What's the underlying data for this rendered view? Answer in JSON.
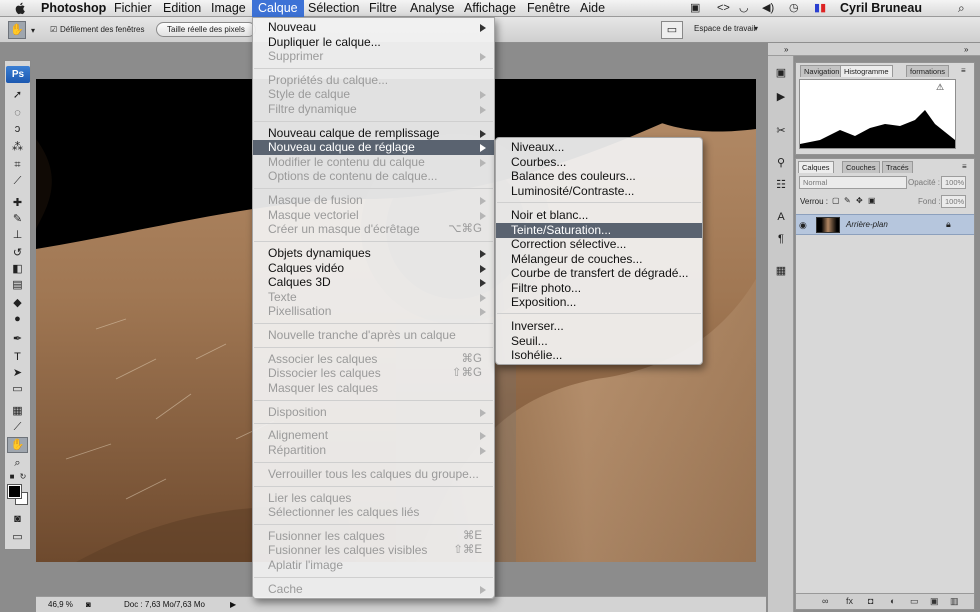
{
  "menubar": {
    "app": "Photoshop",
    "items": [
      "Fichier",
      "Edition",
      "Image",
      "Calque",
      "Sélection",
      "Filtre",
      "Analyse",
      "Affichage",
      "Fenêtre",
      "Aide"
    ],
    "active": "Calque",
    "user": "Cyril Bruneau"
  },
  "options": {
    "scroll_all": "Défilement des fenêtres",
    "actual_pixels": "Taille réelle des pixels",
    "workspace": "Espace de travail"
  },
  "tools": {
    "logo": "Ps"
  },
  "layer_menu": {
    "items": [
      {
        "label": "Nouveau",
        "enabled": true,
        "submenu": true
      },
      {
        "label": "Dupliquer le calque...",
        "enabled": true
      },
      {
        "label": "Supprimer",
        "enabled": false,
        "submenu": true
      },
      {
        "label": "Propriétés du calque...",
        "enabled": false
      },
      {
        "label": "Style de calque",
        "enabled": false,
        "submenu": true
      },
      {
        "label": "Filtre dynamique",
        "enabled": false,
        "submenu": true
      },
      {
        "label": "Nouveau calque de remplissage",
        "enabled": true,
        "submenu": true
      },
      {
        "label": "Nouveau calque de réglage",
        "enabled": true,
        "submenu": true,
        "highlighted": true
      },
      {
        "label": "Modifier le contenu du calque",
        "enabled": false,
        "submenu": true
      },
      {
        "label": "Options de contenu de calque...",
        "enabled": false
      },
      {
        "label": "Masque de fusion",
        "enabled": false,
        "submenu": true
      },
      {
        "label": "Masque vectoriel",
        "enabled": false,
        "submenu": true
      },
      {
        "label": "Créer un masque d'écrêtage",
        "enabled": false,
        "shortcut": "⌥⌘G"
      },
      {
        "label": "Objets dynamiques",
        "enabled": true,
        "submenu": true
      },
      {
        "label": "Calques vidéo",
        "enabled": true,
        "submenu": true
      },
      {
        "label": "Calques 3D",
        "enabled": true,
        "submenu": true
      },
      {
        "label": "Texte",
        "enabled": false,
        "submenu": true
      },
      {
        "label": "Pixellisation",
        "enabled": false,
        "submenu": true
      },
      {
        "label": "Nouvelle tranche d'après un calque",
        "enabled": false
      },
      {
        "label": "Associer les calques",
        "enabled": false,
        "shortcut": "⌘G"
      },
      {
        "label": "Dissocier les calques",
        "enabled": false,
        "shortcut": "⇧⌘G"
      },
      {
        "label": "Masquer les calques",
        "enabled": false
      },
      {
        "label": "Disposition",
        "enabled": false,
        "submenu": true
      },
      {
        "label": "Alignement",
        "enabled": false,
        "submenu": true
      },
      {
        "label": "Répartition",
        "enabled": false,
        "submenu": true
      },
      {
        "label": "Verrouiller tous les calques du groupe...",
        "enabled": false
      },
      {
        "label": "Lier les calques",
        "enabled": false
      },
      {
        "label": "Sélectionner les calques liés",
        "enabled": false
      },
      {
        "label": "Fusionner les calques",
        "enabled": false,
        "shortcut": "⌘E"
      },
      {
        "label": "Fusionner les calques visibles",
        "enabled": false,
        "shortcut": "⇧⌘E"
      },
      {
        "label": "Aplatir l'image",
        "enabled": false
      },
      {
        "label": "Cache",
        "enabled": false,
        "submenu": true
      }
    ]
  },
  "adjust_submenu": {
    "items": [
      {
        "label": "Niveaux..."
      },
      {
        "label": "Courbes..."
      },
      {
        "label": "Balance des couleurs..."
      },
      {
        "label": "Luminosité/Contraste..."
      },
      {
        "label": "Noir et blanc..."
      },
      {
        "label": "Teinte/Saturation...",
        "highlighted": true
      },
      {
        "label": "Correction sélective..."
      },
      {
        "label": "Mélangeur de couches..."
      },
      {
        "label": "Courbe de transfert de dégradé..."
      },
      {
        "label": "Filtre photo..."
      },
      {
        "label": "Exposition..."
      },
      {
        "label": "Inverser..."
      },
      {
        "label": "Seuil..."
      },
      {
        "label": "Isohélie..."
      }
    ]
  },
  "hist_panel": {
    "tabs": [
      "Navigation",
      "Histogramme",
      "formations"
    ],
    "active_tab": "Histogramme",
    "warning_icon": "⚠"
  },
  "layers_panel": {
    "tabs": [
      "Calques",
      "Couches",
      "Tracés"
    ],
    "active_tab": "Calques",
    "blend_mode": "Normal",
    "opacity_label": "Opacité :",
    "opacity_value": "100%",
    "lock_label": "Verrou :",
    "fill_label": "Fond :",
    "fill_value": "100%",
    "layer_name": "Arrière-plan"
  },
  "status": {
    "zoom": "46,9 %",
    "doc": "Doc : 7,63 Mo/7,63 Mo"
  },
  "colors": {
    "menu_highlight": "#5a6370",
    "menubar_active": "#3d72d6",
    "layer_selected": "#b6c6dd"
  }
}
